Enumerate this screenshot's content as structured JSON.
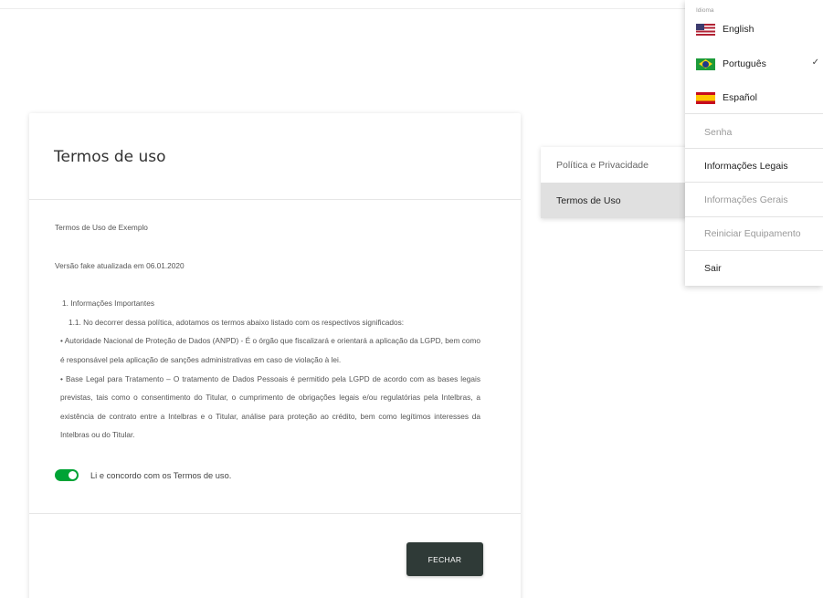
{
  "modal": {
    "title": "Termos de uso",
    "terms": [
      "Termos de Uso de Exemplo",
      "",
      "Versão fake atualizada em 06.01.2020",
      "",
      "1. Informações Importantes",
      "1.1. No decorrer dessa política, adotamos os termos abaixo listado com os respectivos significados:",
      "• Autoridade Nacional de Proteção de Dados (ANPD) - É o órgão que fiscalizará e orientará a aplicação da LGPD, bem como é responsável pela aplicação de sanções administrativas em caso de violação à lei.",
      "• Base Legal para Tratamento – O tratamento de Dados Pessoais é permitido pela LGPD de acordo com as bases legais previstas, tais como o consentimento do Titular, o cumprimento de obrigações legais e/ou regulatórias pela Intelbras, a existência de contrato entre a Intelbras e o Titular, análise para proteção ao crédito, bem como legítimos interesses da Intelbras ou do Titular."
    ],
    "agree_label": "Li e concordo com os Termos de uso.",
    "agree_checked": true,
    "close_label": "FECHAR"
  },
  "tabmenu": {
    "items": [
      {
        "label": "Política e Privacidade",
        "active": false
      },
      {
        "label": "Termos de Uso",
        "active": true
      }
    ]
  },
  "dropdown": {
    "language_caption": "Idioma",
    "languages": [
      {
        "label": "English",
        "icon": "us-flag-icon",
        "selected": false
      },
      {
        "label": "Português",
        "icon": "brazil-flag-icon",
        "selected": true
      },
      {
        "label": "Español",
        "icon": "spain-flag-icon",
        "selected": false
      }
    ],
    "check_mark": "✓",
    "items": [
      {
        "label": "Senha",
        "enabled": false
      },
      {
        "label": "Informações Legais",
        "enabled": true
      },
      {
        "label": "Informações Gerais",
        "enabled": false
      },
      {
        "label": "Reiniciar Equipamento",
        "enabled": false
      },
      {
        "label": "Sair",
        "enabled": true
      }
    ]
  },
  "colors": {
    "toggle_on": "#00a335",
    "close_button": "#2f3a37",
    "active_tab": "#e0e0e0"
  }
}
